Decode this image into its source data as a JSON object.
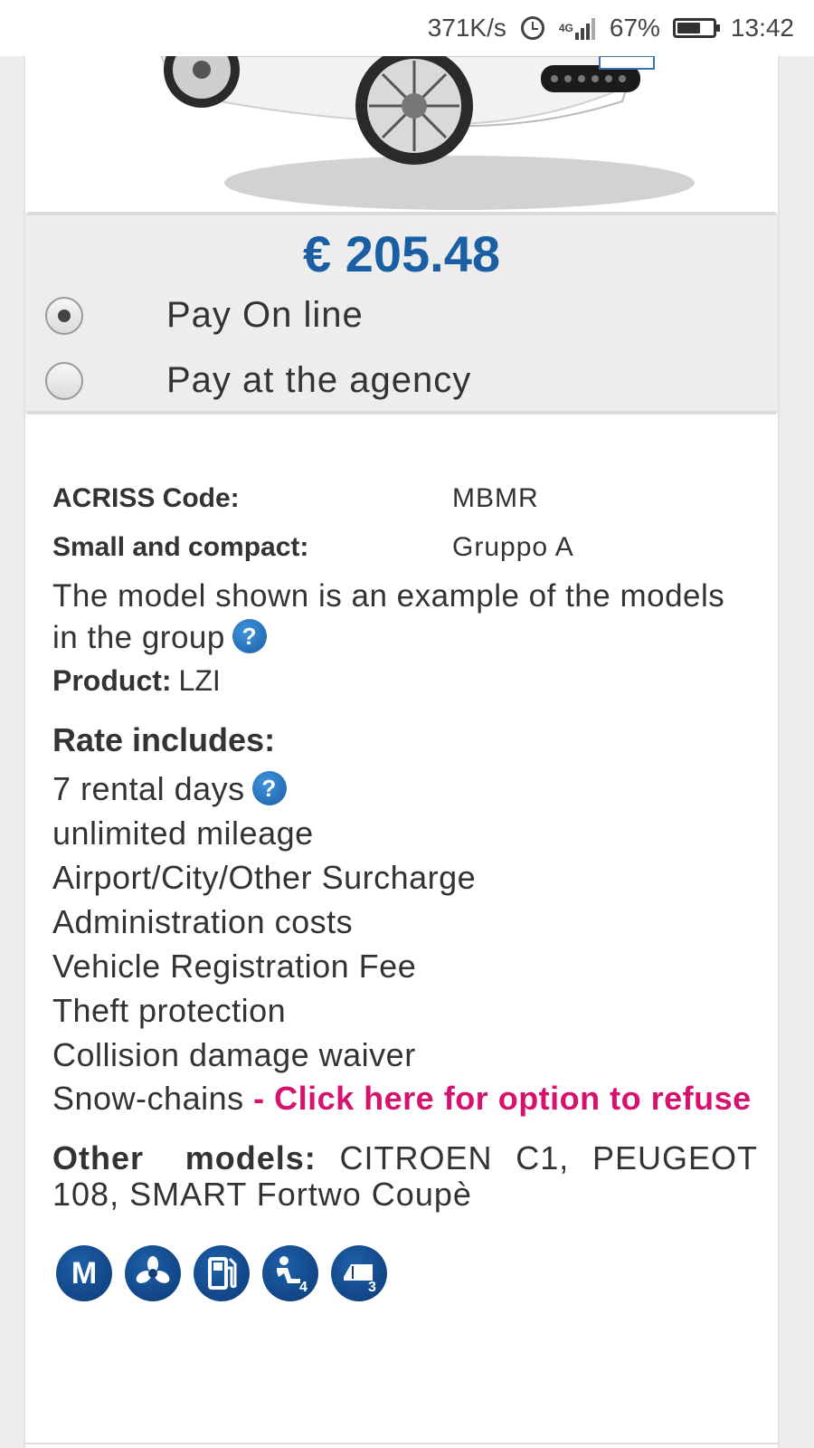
{
  "statusbar": {
    "speed": "371K/s",
    "network": "4G",
    "battery": "67%",
    "battery_level": 0.67,
    "time": "13:42"
  },
  "offer": {
    "price": "€ 205.48",
    "payment_options": [
      {
        "label": "Pay On line",
        "selected": true
      },
      {
        "label": "Pay at the agency",
        "selected": false
      }
    ]
  },
  "specs": [
    {
      "label": "ACRISS Code:",
      "value": "MBMR"
    },
    {
      "label": "Small and compact:",
      "value": "Gruppo A"
    }
  ],
  "model_note": "The model shown is an example of the models in the group",
  "product": {
    "label": "Product:",
    "value": "LZI"
  },
  "rate": {
    "title": "Rate includes:",
    "rental_days": "7 rental days",
    "items": [
      "unlimited mileage",
      "Airport/City/Other Surcharge",
      "Administration costs",
      "Vehicle Registration Fee",
      "Theft protection",
      "Collision damage waiver"
    ],
    "snow_chains": "Snow-chains",
    "refuse_link": "- Click here for option to refuse"
  },
  "other_models": {
    "label": "Other models:",
    "value": "CITROEN C1, PEUGEOT 108, SMART Fortwo Coupè"
  },
  "features": [
    {
      "icon": "manual-transmission-icon",
      "text": "M"
    },
    {
      "icon": "air-conditioning-icon",
      "text": ""
    },
    {
      "icon": "fuel-pump-icon",
      "text": ""
    },
    {
      "icon": "seats-4-icon",
      "text": "4"
    },
    {
      "icon": "doors-3-icon",
      "text": "3"
    }
  ],
  "colors": {
    "price": "#1a5ea3",
    "link": "#d6126e",
    "feature_icon": "#0c3b78"
  }
}
